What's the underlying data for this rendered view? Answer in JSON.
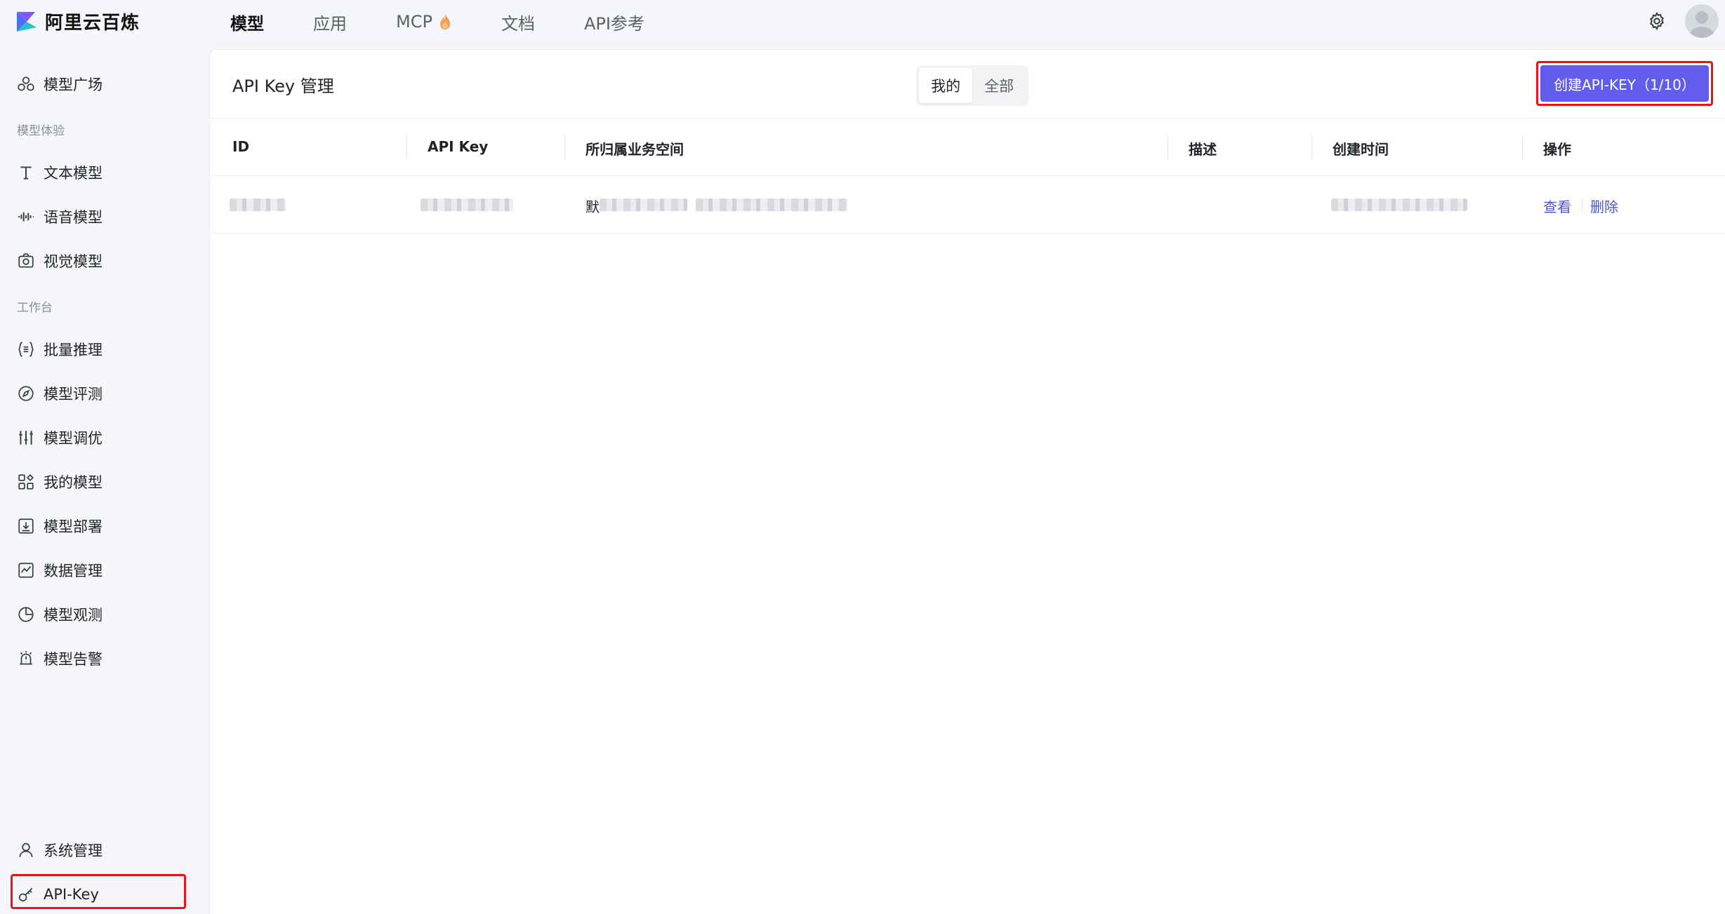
{
  "app": {
    "name": "阿里云百炼"
  },
  "nav": [
    {
      "label": "模型",
      "active": true
    },
    {
      "label": "应用",
      "active": false
    },
    {
      "label": "MCP",
      "active": false,
      "icon": "fire-icon"
    },
    {
      "label": "文档",
      "active": false
    },
    {
      "label": "API参考",
      "active": false
    }
  ],
  "sidebar": {
    "top_item": {
      "label": "模型广场",
      "icon": "model-square-icon"
    },
    "group_experience": "模型体验",
    "experience_items": [
      {
        "label": "文本模型",
        "icon": "text-icon"
      },
      {
        "label": "语音模型",
        "icon": "waveform-icon"
      },
      {
        "label": "视觉模型",
        "icon": "camera-icon"
      }
    ],
    "group_workbench": "工作台",
    "workbench_items": [
      {
        "label": "批量推理",
        "icon": "batch-icon"
      },
      {
        "label": "模型评测",
        "icon": "compass-icon"
      },
      {
        "label": "模型调优",
        "icon": "sliders-icon"
      },
      {
        "label": "我的模型",
        "icon": "grid-icon"
      },
      {
        "label": "模型部署",
        "icon": "deploy-icon"
      },
      {
        "label": "数据管理",
        "icon": "chart-icon"
      },
      {
        "label": "模型观测",
        "icon": "pie-icon"
      },
      {
        "label": "模型告警",
        "icon": "alarm-icon"
      }
    ],
    "bottom_items": [
      {
        "label": "系统管理",
        "icon": "user-icon"
      },
      {
        "label": "API-Key",
        "icon": "key-icon",
        "highlighted": true
      }
    ]
  },
  "main": {
    "title": "API Key 管理",
    "segments": [
      {
        "label": "我的",
        "active": true
      },
      {
        "label": "全部",
        "active": false
      }
    ],
    "create_button": "创建API-KEY（1/10）",
    "table": {
      "columns": [
        "ID",
        "API Key",
        "所归属业务空间",
        "描述",
        "创建时间",
        "操作"
      ],
      "rows": [
        {
          "workspace_prefix": "默",
          "actions": [
            "查看",
            "删除"
          ]
        }
      ]
    }
  },
  "colors": {
    "accent": "#615ced",
    "link": "#4c55d8",
    "highlight": "#e5141c"
  }
}
